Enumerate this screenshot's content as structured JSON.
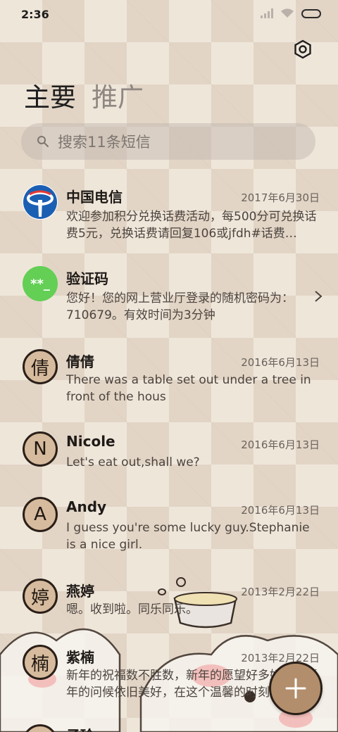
{
  "status": {
    "time": "2:36"
  },
  "tabs": [
    {
      "label": "主要"
    },
    {
      "label": "推广"
    }
  ],
  "search": {
    "placeholder": "搜索11条短信"
  },
  "messages": [
    {
      "sender": "中国电信",
      "date": "2017年6月30日",
      "preview": "欢迎参加积分兑换话费活动，每500分可兑换话费5元，兑换话费请回复106或jfdh#话费…",
      "avatar": "telecom-logo"
    },
    {
      "sender": "验证码",
      "date": "",
      "preview": "您好！您的网上营业厅登录的随机密码为：710679。有效时间为3分钟",
      "avatar_text": "**_"
    },
    {
      "sender": "倩倩",
      "date": "2016年6月13日",
      "preview": "There was a table set out under a tree in front of the hous",
      "avatar_text": "倩"
    },
    {
      "sender": "Nicole",
      "date": "2016年6月13日",
      "preview": "Let's eat out,shall we?",
      "avatar_text": "N"
    },
    {
      "sender": "Andy",
      "date": "2016年6月13日",
      "preview": "I guess you're some lucky guy.Stephanie is a nice girl.",
      "avatar_text": "A"
    },
    {
      "sender": "燕婷",
      "date": "2013年2月22日",
      "preview": "嗯。收到啦。同乐同乐。",
      "avatar_text": "婷"
    },
    {
      "sender": "紫楠",
      "date": "2013年2月22日",
      "preview": "新年的祝福数不胜数，新年的愿望好多好多，新年的问候依旧美好，在这个温馨的时刻",
      "avatar_text": "楠"
    },
    {
      "sender": "子玲",
      "date": "",
      "preview": "",
      "avatar_text": ""
    }
  ],
  "colors": {
    "accent": "#b38e6c",
    "avatar_fill": "#d7bb9e",
    "verification_green": "#63cf55",
    "telecom_blue": "#1b5fb3"
  }
}
